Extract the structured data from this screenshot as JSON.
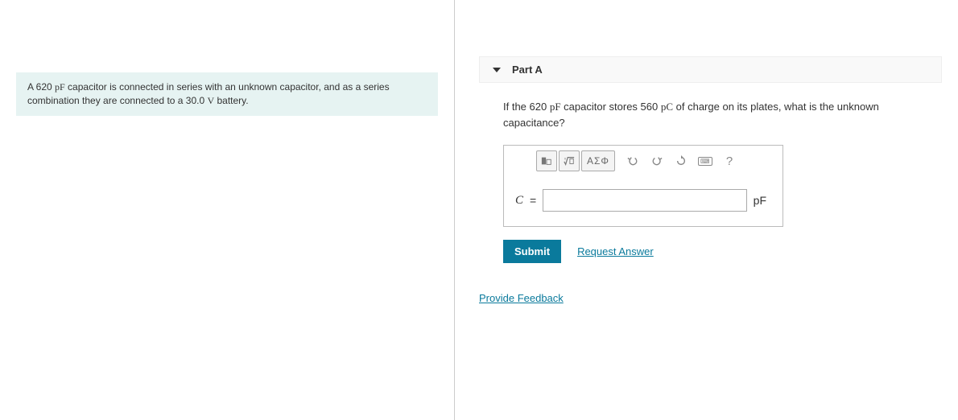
{
  "problem": {
    "text_prefix": "A 620 ",
    "unit1": "pF",
    "text_mid": " capacitor is connected in series with an unknown capacitor, and as a series combination they are connected to a 30.0 ",
    "unit2": "V",
    "text_suffix": " battery."
  },
  "part": {
    "label": "Part A",
    "question_prefix": "If the 620 ",
    "question_unit1": "pF",
    "question_mid": " capacitor stores 560 ",
    "question_unit2": "pC",
    "question_suffix": " of charge on its plates, what is the unknown capacitance?"
  },
  "toolbar": {
    "greek": "ΑΣΦ",
    "help": "?"
  },
  "answer": {
    "var": "C",
    "equals": "=",
    "placeholder": "",
    "unit": "pF"
  },
  "actions": {
    "submit": "Submit",
    "request": "Request Answer",
    "feedback": "Provide Feedback"
  }
}
